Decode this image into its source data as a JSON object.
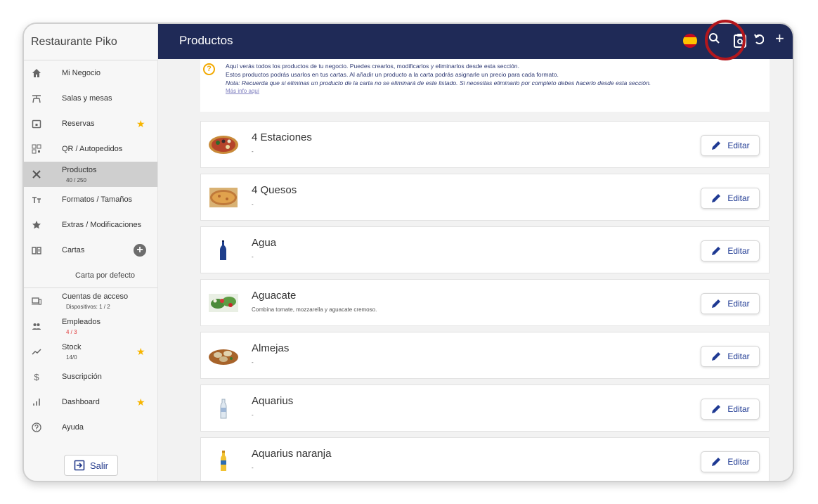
{
  "sidebar": {
    "brand": "Restaurante Piko",
    "items": [
      {
        "label": "Mi Negocio",
        "icon": "home-icon"
      },
      {
        "label": "Salas y mesas",
        "icon": "table-icon"
      },
      {
        "label": "Reservas",
        "icon": "calendar-icon",
        "star": true
      },
      {
        "label": "QR / Autopedidos",
        "icon": "qr-code-icon"
      },
      {
        "label": "Productos",
        "sub": "40 / 250",
        "icon": "utensils-icon",
        "active": true
      },
      {
        "label": "Formatos / Tamaños",
        "icon": "text-size-icon"
      },
      {
        "label": "Extras / Modificaciones",
        "icon": "star-icon"
      },
      {
        "label": "Cartas",
        "icon": "menu-book-icon",
        "add": true
      }
    ],
    "carta_default": "Carta por defecto",
    "items2": [
      {
        "label": "Cuentas de acceso",
        "sub": "Dispositivos: 1 / 2",
        "icon": "devices-icon"
      },
      {
        "label": "Empleados",
        "sub": "4 / 3",
        "sub_color": "#e03a3a",
        "icon": "people-icon"
      },
      {
        "label": "Stock",
        "sub": "14/0",
        "icon": "trend-icon",
        "star": true
      },
      {
        "label": "Suscripción",
        "icon": "dollar-icon"
      },
      {
        "label": "Dashboard",
        "icon": "bar-chart-icon",
        "star": true
      },
      {
        "label": "Ayuda",
        "icon": "help-icon"
      }
    ],
    "salir": "Salir"
  },
  "header": {
    "title": "Productos"
  },
  "info": {
    "line1": "Aquí verás todos los productos de tu negocio. Puedes crearlos, modificarlos y eliminarlos desde esta sección.",
    "line2": "Estos productos podrás usarlos en tus cartas. Al añadir un producto a la carta podrás asignarle un precio para cada formato.",
    "note": "Nota: Recuerda que si eliminas un producto de la carta no se eliminará de este listado. Si necesitas eliminarlo por completo debes hacerlo desde esta sección.",
    "more": "Más info aquí"
  },
  "products": [
    {
      "name": "4 Estaciones",
      "desc": "-",
      "img": "pizza"
    },
    {
      "name": "4 Quesos",
      "desc": "-",
      "img": "pizza-cheese"
    },
    {
      "name": "Agua",
      "desc": "-",
      "img": "water-bottle"
    },
    {
      "name": "Aguacate",
      "desc": "Combina tomate, mozzarella y aguacate cremoso.",
      "img": "salad"
    },
    {
      "name": "Almejas",
      "desc": "-",
      "img": "clams"
    },
    {
      "name": "Aquarius",
      "desc": "-",
      "img": "bottle-clear"
    },
    {
      "name": "Aquarius naranja",
      "desc": "-",
      "img": "bottle-orange"
    }
  ],
  "edit_label": "Editar",
  "colors": {
    "header": "#1f2a57",
    "star": "#f7b500",
    "highlight": "#b3171d"
  }
}
